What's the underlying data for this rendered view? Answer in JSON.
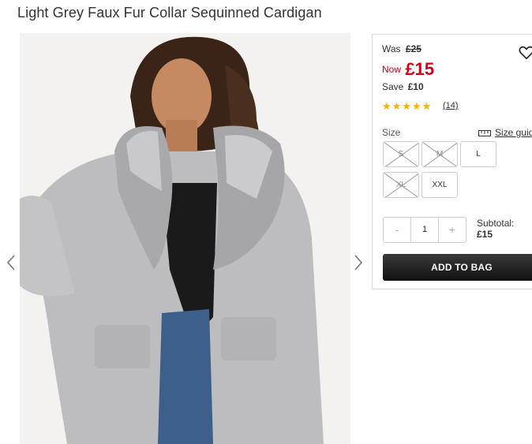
{
  "product": {
    "title": "Light Grey Faux Fur Collar Sequinned Cardigan"
  },
  "gallery": {
    "prev_icon": "chevron-left-icon",
    "next_icon": "chevron-right-icon"
  },
  "pricing": {
    "was_label": "Was",
    "was_price": "£25",
    "now_label": "Now",
    "now_price": "£15",
    "save_label": "Save",
    "save_amount": "£10",
    "sale_color": "#d0021b"
  },
  "rating": {
    "stars": "★★★★★",
    "value": 5,
    "review_count": "(14)"
  },
  "sizes": {
    "label": "Size",
    "guide_label": "Size guide",
    "options": [
      {
        "label": "S",
        "available": false
      },
      {
        "label": "M",
        "available": false
      },
      {
        "label": "L",
        "available": true
      },
      {
        "label": "XL",
        "available": false
      },
      {
        "label": "XXL",
        "available": true
      }
    ]
  },
  "quantity": {
    "minus": "-",
    "value": "1",
    "plus": "+"
  },
  "subtotal": {
    "label": "Subtotal:",
    "amount": "£15"
  },
  "actions": {
    "add_to_bag": "ADD TO BAG",
    "wishlist_icon": "heart-icon"
  }
}
